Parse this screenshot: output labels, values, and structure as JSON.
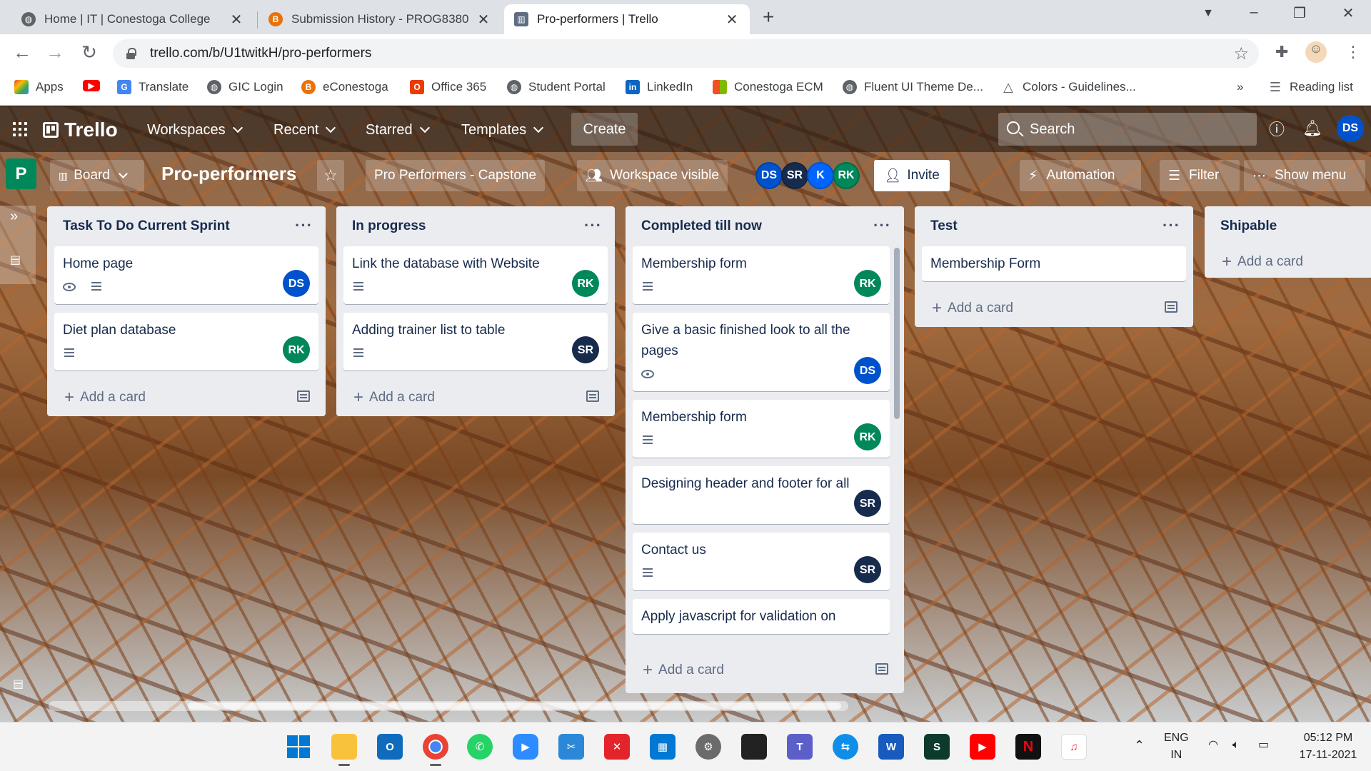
{
  "browser": {
    "tabs": [
      {
        "title": "Home | IT | Conestoga College",
        "icon": "globe-icon",
        "active": false
      },
      {
        "title": "Submission History - PROG8380-",
        "icon": "brightspace-icon",
        "active": false
      },
      {
        "title": "Pro-performers | Trello",
        "icon": "trello-icon",
        "active": true
      }
    ],
    "url": "trello.com/b/U1twitkH/pro-performers",
    "bookmarks": [
      {
        "label": "Apps",
        "icon": "apps-grid-icon"
      },
      {
        "label": "",
        "icon": "youtube-icon"
      },
      {
        "label": "Translate",
        "icon": "translate-icon"
      },
      {
        "label": "GIC Login",
        "icon": "globe-icon"
      },
      {
        "label": "eConestoga",
        "icon": "brightspace-icon"
      },
      {
        "label": "Office 365",
        "icon": "office-icon"
      },
      {
        "label": "Student Portal",
        "icon": "globe-icon"
      },
      {
        "label": "LinkedIn",
        "icon": "linkedin-icon"
      },
      {
        "label": "Conestoga ECM",
        "icon": "microsoft-icon"
      },
      {
        "label": "Fluent UI Theme De...",
        "icon": "globe-icon"
      },
      {
        "label": "Colors - Guidelines...",
        "icon": "triangle-icon"
      }
    ],
    "reading_list": "Reading list",
    "overflow": "»"
  },
  "trello": {
    "nav": {
      "logo": "Trello",
      "workspaces": "Workspaces",
      "recent": "Recent",
      "starred": "Starred",
      "templates": "Templates",
      "create": "Create",
      "search_placeholder": "Search",
      "user_initials": "DS"
    },
    "board": {
      "workspace_letter": "P",
      "view": "Board",
      "title": "Pro-performers",
      "workspace_name": "Pro Performers - Capstone",
      "visibility": "Workspace visible",
      "members": [
        "DS",
        "SR",
        "K",
        "RK"
      ],
      "invite": "Invite",
      "automation": "Automation",
      "filter": "Filter",
      "show_menu": "Show menu"
    },
    "lists": [
      {
        "title": "Task To Do Current Sprint",
        "cards": [
          {
            "title": "Home page",
            "badges": [
              "eye",
              "desc"
            ],
            "member": "DS"
          },
          {
            "title": "Diet plan database",
            "badges": [
              "desc"
            ],
            "member": "RK"
          }
        ]
      },
      {
        "title": "In progress",
        "cards": [
          {
            "title": "Link the database with Website",
            "badges": [
              "desc"
            ],
            "member": "RK"
          },
          {
            "title": "Adding trainer list to table",
            "badges": [
              "desc"
            ],
            "member": "SR"
          }
        ]
      },
      {
        "title": "Completed till now",
        "cards": [
          {
            "title": "Membership form",
            "badges": [
              "desc"
            ],
            "member": "RK"
          },
          {
            "title": "Give a basic finished look to all the pages",
            "badges": [
              "eye"
            ],
            "member": "DS"
          },
          {
            "title": "Membership form",
            "badges": [
              "desc"
            ],
            "member": "RK"
          },
          {
            "title": "Designing header and footer for all",
            "badges": [],
            "member": "SR"
          },
          {
            "title": "Contact us",
            "badges": [
              "desc"
            ],
            "member": "SR"
          },
          {
            "title": "Apply javascript for validation on",
            "badges": [],
            "member": ""
          }
        ]
      },
      {
        "title": "Test",
        "cards": [
          {
            "title": "Membership Form",
            "badges": [],
            "member": ""
          }
        ]
      },
      {
        "title": "Shipable",
        "cards": []
      }
    ],
    "add_card": "Add a card"
  },
  "taskbar": {
    "language": "ENG",
    "region": "IN",
    "time": "05:12 PM",
    "date": "17-11-2021"
  },
  "colors": {
    "ds": "#0052cc",
    "rk": "#00875a",
    "sr": "#172b4d",
    "k": "#0065ff"
  }
}
